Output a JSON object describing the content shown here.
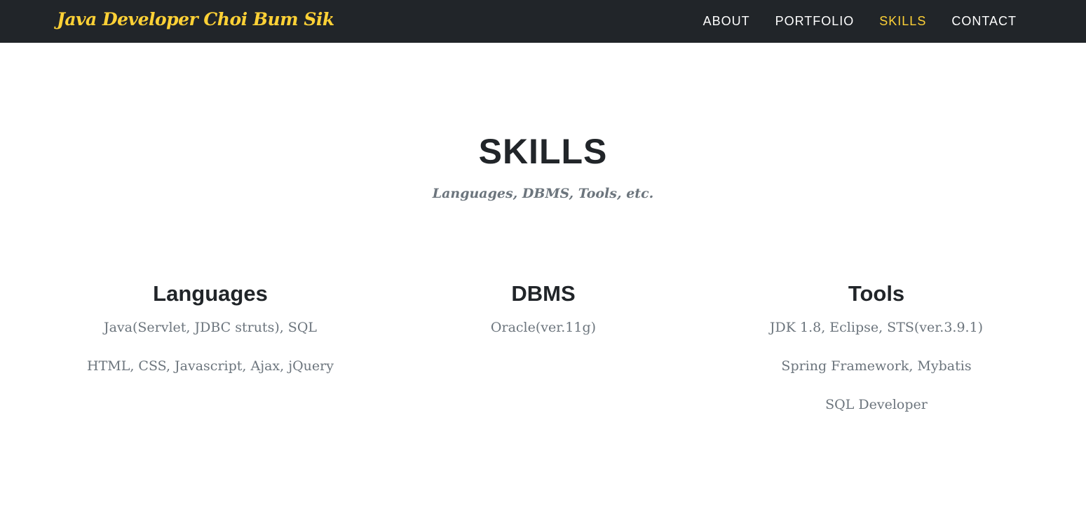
{
  "navbar": {
    "brand": "Java Developer Choi Bum Sik",
    "links": [
      {
        "label": "ABOUT",
        "active": false
      },
      {
        "label": "PORTFOLIO",
        "active": false
      },
      {
        "label": "SKILLS",
        "active": true
      },
      {
        "label": "CONTACT",
        "active": false
      }
    ]
  },
  "section": {
    "heading": "SKILLS",
    "subheading": "Languages, DBMS, Tools, etc."
  },
  "columns": [
    {
      "title": "Languages",
      "items": [
        "Java(Servlet, JDBC struts), SQL",
        "HTML, CSS, Javascript, Ajax, jQuery"
      ]
    },
    {
      "title": "DBMS",
      "items": [
        "Oracle(ver.11g)"
      ]
    },
    {
      "title": "Tools",
      "items": [
        "JDK 1.8, Eclipse, STS(ver.3.9.1)",
        "Spring Framework, Mybatis",
        "SQL Developer"
      ]
    }
  ],
  "colors": {
    "navbar_bg": "#212529",
    "accent": "#fed136",
    "heading": "#212529",
    "muted": "#6c757d"
  }
}
